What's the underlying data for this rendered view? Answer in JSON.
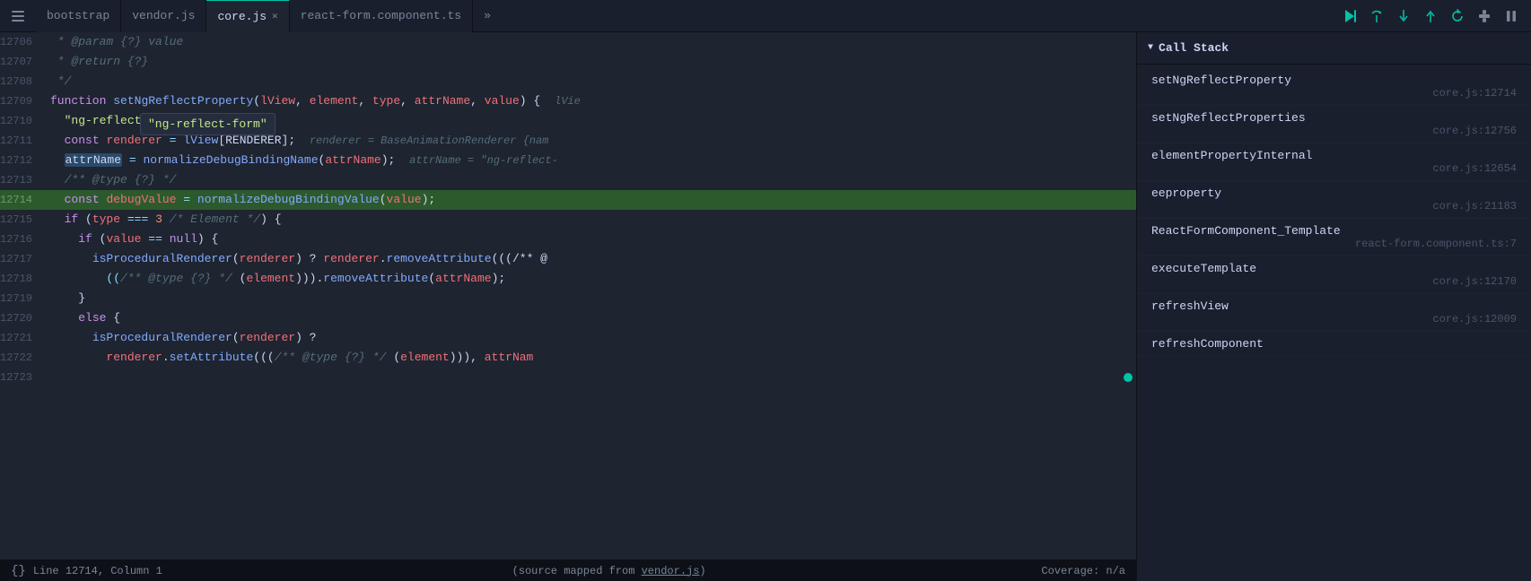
{
  "tabs": [
    {
      "id": "bootstrap",
      "label": "bootstrap",
      "active": false,
      "closable": false
    },
    {
      "id": "vendor",
      "label": "vendor.js",
      "active": false,
      "closable": false
    },
    {
      "id": "core",
      "label": "core.js",
      "active": true,
      "closable": true
    },
    {
      "id": "react-form",
      "label": "react-form.component.ts",
      "active": false,
      "closable": false
    }
  ],
  "tab_overflow_label": "»",
  "debug_buttons": [
    {
      "id": "continue",
      "icon": "▶",
      "color": "teal"
    },
    {
      "id": "step-over",
      "icon": "↺",
      "color": "teal"
    },
    {
      "id": "step-into",
      "icon": "↓",
      "color": "teal"
    },
    {
      "id": "step-out",
      "icon": "↑",
      "color": "teal"
    },
    {
      "id": "restart",
      "icon": "⟳",
      "color": "teal"
    },
    {
      "id": "disconnect",
      "icon": "⏏",
      "color": "dimmed"
    },
    {
      "id": "pause",
      "icon": "⏸",
      "color": "dimmed"
    }
  ],
  "code": {
    "lines": [
      {
        "num": "12706",
        "content": " * @param {?} value",
        "type": "comment"
      },
      {
        "num": "12707",
        "content": " * @return {?}",
        "type": "comment"
      },
      {
        "num": "12708",
        "content": " */",
        "type": "comment"
      },
      {
        "num": "12709",
        "content": "function setNgReflectProperty(lView, element, type, attrName, value) { ",
        "type": "code",
        "hasInline": true,
        "inlineText": "lVie"
      },
      {
        "num": "12710",
        "content": "  \"ng-reflect-form\"",
        "type": "str_only",
        "tooltip": true
      },
      {
        "num": "12711",
        "content": "  const renderer = lView[RENDERER];",
        "type": "code",
        "hasInline": true,
        "inlineText": "renderer = BaseAnimationRenderer {nam"
      },
      {
        "num": "12712",
        "content": "  attrName = normalizeDebugBindingName(attrName);",
        "type": "code",
        "hasInline": true,
        "inlineText": "attrName = \"ng-reflect-"
      },
      {
        "num": "12713",
        "content": "  /** @type {?} */",
        "type": "comment"
      },
      {
        "num": "12714",
        "content": "  const debugValue = normalizeDebugBindingValue(value);",
        "type": "code",
        "active": true
      },
      {
        "num": "12715",
        "content": "  if (type === 3 /* Element */) {",
        "type": "code"
      },
      {
        "num": "12716",
        "content": "    if (value == null) {",
        "type": "code"
      },
      {
        "num": "12717",
        "content": "      isProceduralRenderer(renderer) ? renderer.removeAttribute(((/** @",
        "type": "code"
      },
      {
        "num": "12718",
        "content": "        ((/** @type {?} */ (element))).removeAttribute(attrName);",
        "type": "code"
      },
      {
        "num": "12719",
        "content": "    }",
        "type": "code"
      },
      {
        "num": "12720",
        "content": "    else {",
        "type": "code"
      },
      {
        "num": "12721",
        "content": "      isProceduralRenderer(renderer) ?",
        "type": "code"
      },
      {
        "num": "12722",
        "content": "        renderer.setAttribute(((/** @type {?} */ (element))), attrNam",
        "type": "code"
      },
      {
        "num": "12723",
        "content": "",
        "type": "code",
        "hasDot": true
      }
    ]
  },
  "tooltip": {
    "text": "\"ng-reflect-form\""
  },
  "call_stack": {
    "title": "Call Stack",
    "items": [
      {
        "fn": "setNgReflectProperty",
        "file": "core.js:12714",
        "active": false
      },
      {
        "fn": "setNgReflectProperties",
        "file": "core.js:12756",
        "active": false
      },
      {
        "fn": "elementPropertyInternal",
        "file": "core.js:12654",
        "active": false
      },
      {
        "fn": "eeproperty",
        "file": "core.js:21183",
        "active": false
      },
      {
        "fn": "ReactFormComponent_Template",
        "file": "react-form.component.ts:7",
        "active": false
      },
      {
        "fn": "executeTemplate",
        "file": "core.js:12170",
        "active": false
      },
      {
        "fn": "refreshView",
        "file": "core.js:12009",
        "active": false
      },
      {
        "fn": "refreshComponent",
        "file": "",
        "active": false
      }
    ]
  },
  "status": {
    "icon": "{}",
    "position": "Line 12714, Column 1",
    "source_text": "(source mapped from ",
    "source_link": "vendor.js",
    "source_end": ")",
    "coverage": "Coverage: n/a"
  }
}
